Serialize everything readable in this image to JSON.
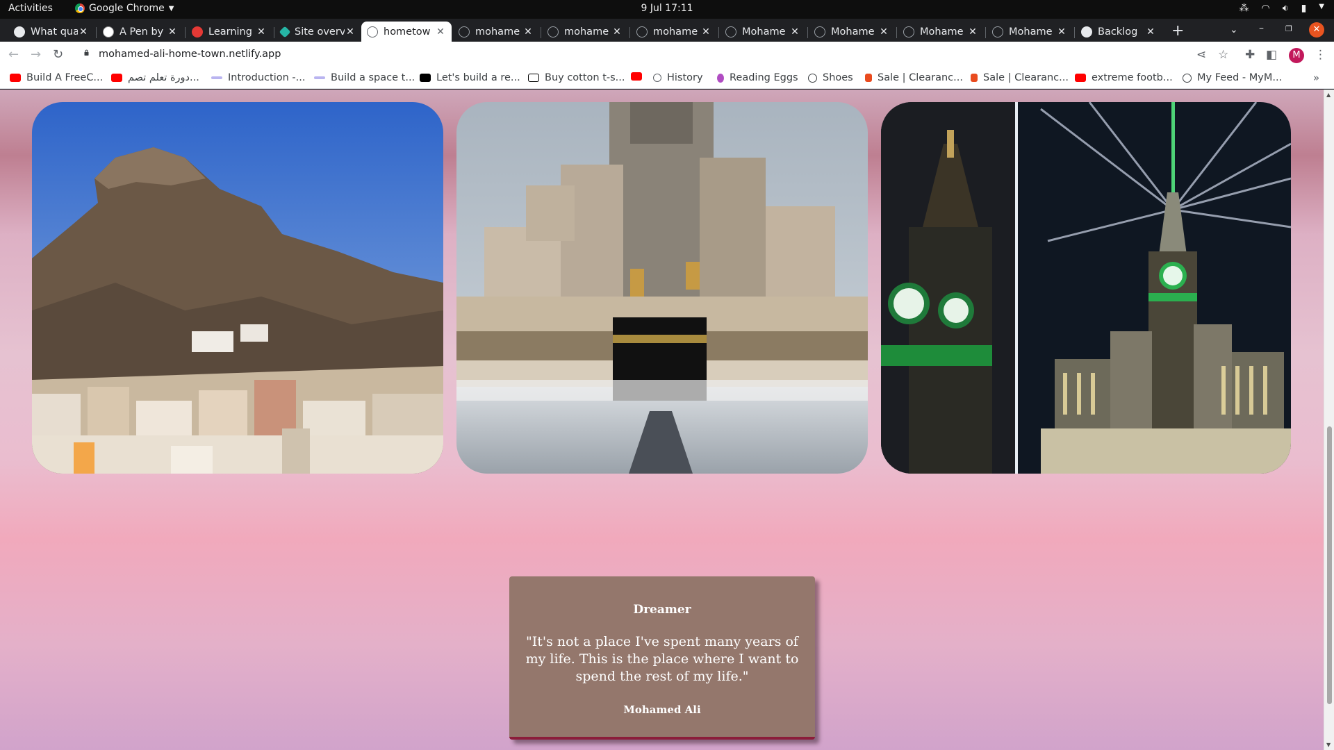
{
  "system_bar": {
    "activities": "Activities",
    "app_name": "Google Chrome",
    "clock": "9 Jul  17:11",
    "tray_icons": [
      "network-icon",
      "wifi-icon",
      "volume-icon",
      "battery-icon",
      "power-menu-icon"
    ]
  },
  "tabs": [
    {
      "title": "What qua",
      "favicon": "github-icon"
    },
    {
      "title": "A Pen by",
      "favicon": "codepen-icon"
    },
    {
      "title": "Learning",
      "favicon": "learning-icon"
    },
    {
      "title": "Site overv",
      "favicon": "netlify-icon"
    },
    {
      "title": "hometow",
      "favicon": "globe-icon",
      "active": true
    },
    {
      "title": "mohame",
      "favicon": "globe-icon"
    },
    {
      "title": "mohame",
      "favicon": "globe-icon"
    },
    {
      "title": "mohame",
      "favicon": "globe-icon"
    },
    {
      "title": "Mohame",
      "favicon": "globe-icon"
    },
    {
      "title": "Mohame",
      "favicon": "globe-icon"
    },
    {
      "title": "Mohame",
      "favicon": "globe-icon"
    },
    {
      "title": "Mohame",
      "favicon": "globe-icon"
    },
    {
      "title": "Backlog",
      "favicon": "github-icon"
    }
  ],
  "address_bar": {
    "url": "mohamed-ali-home-town.netlify.app",
    "profile_initial": "M"
  },
  "bookmarks": [
    {
      "label": "Build A FreeC...",
      "icon": "youtube-icon"
    },
    {
      "label": "دورة تعلم تصم...",
      "icon": "youtube-icon"
    },
    {
      "label": "Introduction -...",
      "icon": "doc-icon"
    },
    {
      "label": "Build a space t...",
      "icon": "doc-icon"
    },
    {
      "label": "Let's build a re...",
      "icon": "dev-icon"
    },
    {
      "label": "Buy cotton t-s...",
      "icon": "n-icon"
    },
    {
      "label": "",
      "icon": "youtube-icon"
    },
    {
      "label": "History",
      "icon": "history-icon"
    },
    {
      "label": "Reading Eggs",
      "icon": "egg-icon"
    },
    {
      "label": "Shoes",
      "icon": "globe-icon"
    },
    {
      "label": "Sale | Clearanc...",
      "icon": "store-icon"
    },
    {
      "label": "Sale | Clearanc...",
      "icon": "store-icon"
    },
    {
      "label": "extreme footb...",
      "icon": "youtube-icon"
    },
    {
      "label": "My Feed - MyM...",
      "icon": "globe-icon"
    }
  ],
  "gallery": [
    {
      "name": "mountain-photo"
    },
    {
      "name": "kaaba-photo"
    },
    {
      "name": "clock-tower-photo"
    }
  ],
  "quote": {
    "heading": "Dreamer",
    "text": "\"It's not a place I've spent many years of my life. This is the place where I want to spend the rest of my life.\"",
    "author": "Mohamed Ali"
  },
  "colors": {
    "quote_card": "#94776c",
    "quote_border": "#8b1d3a",
    "close_button": "#e95420",
    "avatar": "#c2185b"
  }
}
